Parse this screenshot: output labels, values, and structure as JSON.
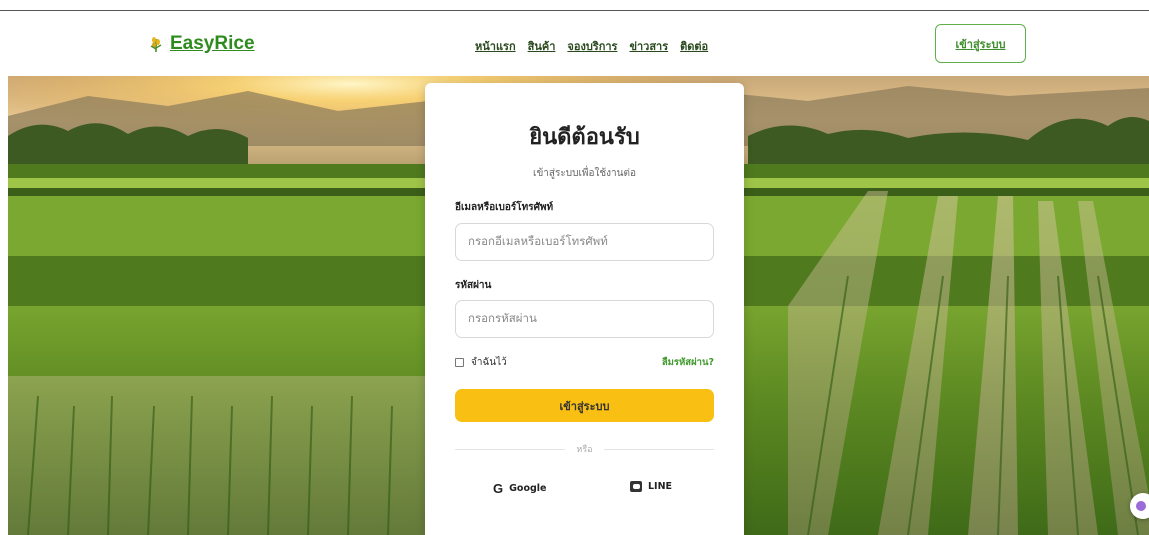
{
  "header": {
    "logo_text": "EasyRice",
    "nav": [
      "หน้าแรก",
      "สินค้า",
      "จองบริการ",
      "ข่าวสาร",
      "ติดต่อ"
    ],
    "login_label": "เข้าสู่ระบบ"
  },
  "card": {
    "title": "ยินดีต้อนรับ",
    "subtitle": "เข้าสู่ระบบเพื่อใช้งานต่อ",
    "email_label": "อีเมลหรือเบอร์โทรศัพท์",
    "email_placeholder": "กรอกอีเมลหรือเบอร์โทรศัพท์",
    "password_label": "รหัสผ่าน",
    "password_placeholder": "กรอกรหัสผ่าน",
    "remember_label": "จำฉันไว้",
    "forgot_label": "ลืมรหัสผ่าน?",
    "submit_label": "เข้าสู่ระบบ",
    "divider_text": "หรือ",
    "google_label": "Google",
    "line_label": "LINE"
  },
  "icons": {
    "logo": "rice-stalk-icon",
    "google": "google-icon",
    "line": "line-icon",
    "fab": "chat-bubble-icon"
  },
  "colors": {
    "brand_green": "#2e8b1e",
    "accent_yellow": "#f9bf13"
  }
}
